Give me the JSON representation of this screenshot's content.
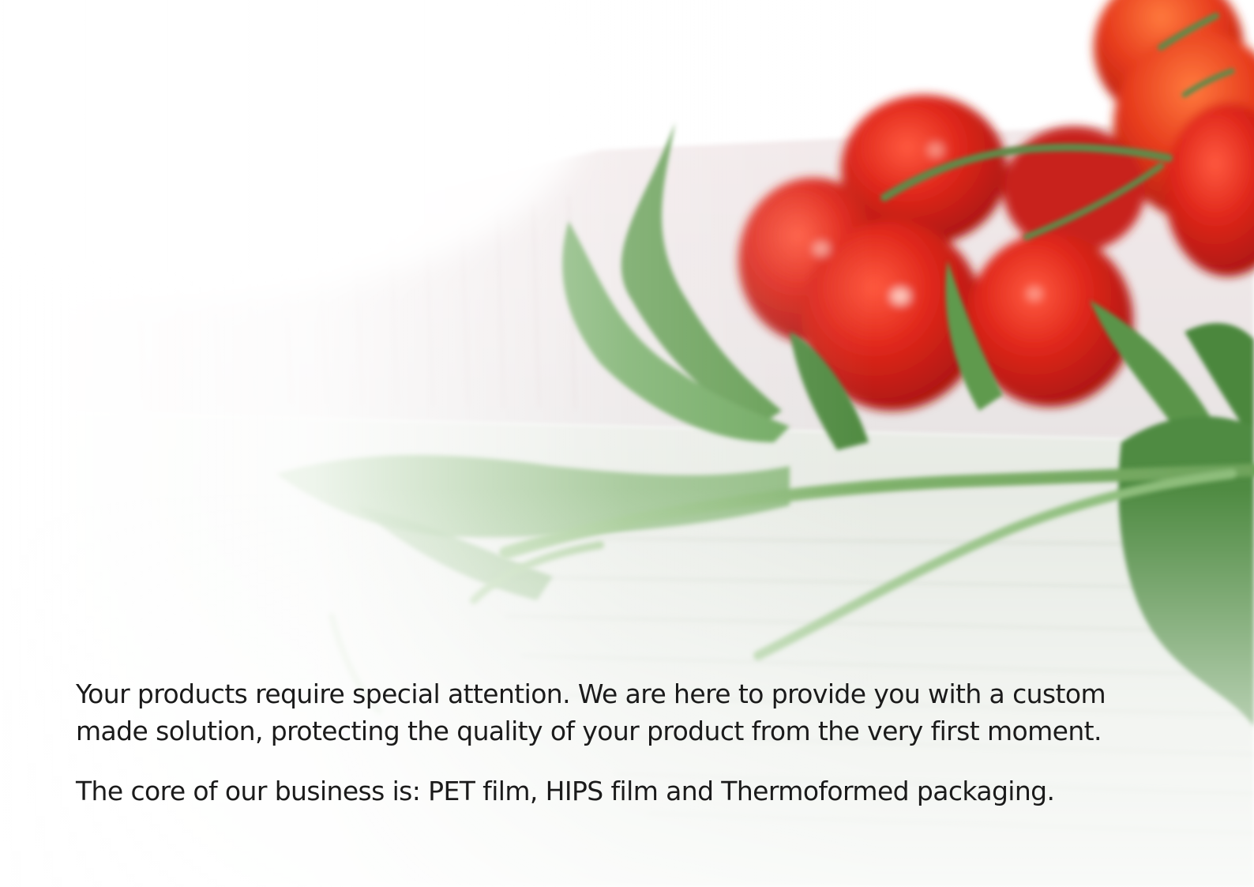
{
  "document": {
    "paragraphs": [
      "Your products require special attention. We are here to provide you with a custom made solution, protecting the quality of your product from the very first moment.",
      "The core of our business is: PET film, HIPS film and Thermoformed packaging."
    ]
  },
  "image": {
    "subject": "cherry-tomatoes-and-arugula-in-clear-plastic-tray",
    "colors": {
      "tomato": "#d9231a",
      "leaf": "#5f9a4e",
      "plastic": "#f4eeee"
    }
  }
}
